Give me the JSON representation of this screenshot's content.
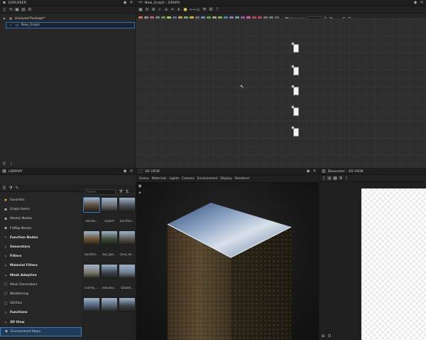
{
  "explorer": {
    "title": "EXPLORER",
    "package_name": "Unsaved Package*",
    "graph_item": "New_Graph"
  },
  "graph": {
    "title": "New_Graph - GRAPH",
    "preset_label": "Parent Size",
    "node_count": 5
  },
  "library": {
    "title": "LIBRARY",
    "search_placeholder": "Search",
    "categories": [
      {
        "label": "Favorites",
        "bold": false,
        "selected": false,
        "icon": "star-icon"
      },
      {
        "label": "Graph Items",
        "bold": false,
        "selected": false,
        "icon": "folder-icon"
      },
      {
        "label": "Atomic Nodes",
        "bold": false,
        "selected": false,
        "icon": "folder-icon"
      },
      {
        "label": "FxMap Nodes",
        "bold": false,
        "selected": false,
        "icon": "folder-icon"
      },
      {
        "label": "Function Nodes",
        "bold": true,
        "selected": false,
        "icon": "chevron-right-icon"
      },
      {
        "label": "Generators",
        "bold": true,
        "selected": false,
        "icon": "chevron-right-icon"
      },
      {
        "label": "Filters",
        "bold": true,
        "selected": false,
        "icon": "chevron-right-icon"
      },
      {
        "label": "Material Filters",
        "bold": true,
        "selected": false,
        "icon": "chevron-right-icon"
      },
      {
        "label": "Mesh Adaptive",
        "bold": true,
        "selected": false,
        "icon": "chevron-down-icon"
      },
      {
        "label": "Mask Generators",
        "bold": false,
        "selected": false,
        "icon": "circle-icon"
      },
      {
        "label": "Weathering",
        "bold": false,
        "selected": false,
        "icon": "circle-icon"
      },
      {
        "label": "Utilities",
        "bold": false,
        "selected": false,
        "icon": "circle-icon"
      },
      {
        "label": "Functions",
        "bold": true,
        "selected": false,
        "icon": "chevron-right-icon"
      },
      {
        "label": "3D View",
        "bold": true,
        "selected": false,
        "icon": "chevron-down-icon"
      },
      {
        "label": "Environment Maps",
        "bold": false,
        "selected": true,
        "icon": "folder-icon"
      }
    ],
    "thumbnails": [
      {
        "label": "alendo...",
        "color": "#5a4a3a",
        "selected": true
      },
      {
        "label": "airport",
        "color": "#6c6e72"
      },
      {
        "label": "bonifaci...",
        "color": "#4a5058"
      },
      {
        "label": "bonifaci...",
        "color": "#6a5436"
      },
      {
        "label": "bus_gar...",
        "color": "#3e4a38"
      },
      {
        "label": "cave_en...",
        "color": "#5a5650"
      },
      {
        "label": "corrido_...",
        "color": "#7e7a70"
      },
      {
        "label": "elevator...",
        "color": "#3b4550"
      },
      {
        "label": "Glazed...",
        "color": "#6f8094"
      },
      {
        "label": "",
        "color": "#4e5e74"
      },
      {
        "label": "",
        "color": "#556070"
      },
      {
        "label": "",
        "color": "#3a4048"
      }
    ]
  },
  "view3d": {
    "title": "3D VIEW",
    "menu": [
      "Scene",
      "Materials",
      "Lights",
      "Camera",
      "Environment",
      "Display",
      "Renderer"
    ]
  },
  "view2d": {
    "title": "Basecolor - 2D VIEW"
  }
}
